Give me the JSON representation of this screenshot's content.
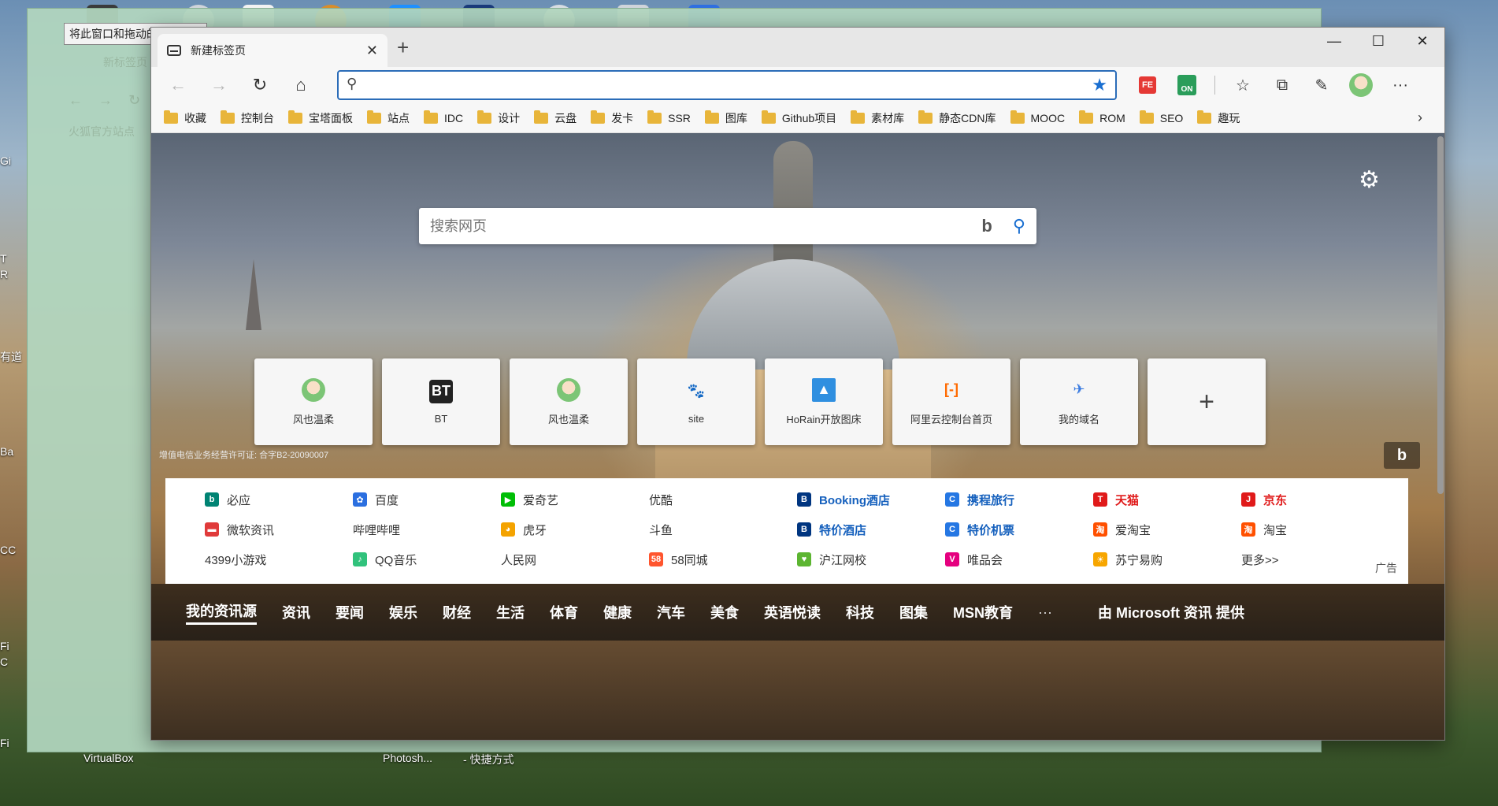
{
  "desktop": {
    "ghost_tooltip": "将此窗口和拖动的窗口分组",
    "ghost_tab": "新标签页",
    "ghost_bookmark": "火狐官方站点",
    "left_labels": [
      "Gi",
      "T",
      "R",
      "有道",
      "Ba",
      "CC",
      "Fi",
      "C",
      "Fi"
    ],
    "bottom_labels": [
      "VirtualBox",
      "Photosh...",
      "- 快捷方式"
    ]
  },
  "browser": {
    "tab_title": "新建标签页",
    "address_placeholder": "",
    "bookmarks": [
      "收藏",
      "控制台",
      "宝塔面板",
      "站点",
      "IDC",
      "设计",
      "云盘",
      "发卡",
      "SSR",
      "图库",
      "Github项目",
      "素材库",
      "静态CDN库",
      "MOOC",
      "ROM",
      "SEO",
      "趣玩"
    ],
    "ext_fe": "FE",
    "ext_on": "ON"
  },
  "newtab": {
    "search_placeholder": "搜索网页",
    "tiles": [
      {
        "label": "风也温柔",
        "icon": "avatar-icon"
      },
      {
        "label": "BT",
        "icon": "bt-icon"
      },
      {
        "label": "风也温柔",
        "icon": "avatar-icon"
      },
      {
        "label": "site",
        "icon": "baidu-paw-icon"
      },
      {
        "label": "HoRain开放图床",
        "icon": "image-icon"
      },
      {
        "label": "阿里云控制台首页",
        "icon": "aliyun-icon"
      },
      {
        "label": "我的域名",
        "icon": "plane-icon"
      }
    ],
    "tile_bt_text": "BT",
    "license": "增值电信业务经营许可证: 合字B2-20090007",
    "links": [
      {
        "label": "必应",
        "style": "normal",
        "icon": "bing",
        "color": "#008373"
      },
      {
        "label": "百度",
        "style": "normal",
        "icon": "baidu",
        "color": "#2b6fe0"
      },
      {
        "label": "爱奇艺",
        "style": "normal",
        "icon": "iqiyi",
        "color": "#00be06"
      },
      {
        "label": "优酷",
        "style": "normal",
        "icon": "",
        "color": ""
      },
      {
        "label": "Booking酒店",
        "style": "bold-blue",
        "icon": "booking",
        "color": "#003580"
      },
      {
        "label": "携程旅行",
        "style": "bold-blue",
        "icon": "ctrip",
        "color": "#2577e3"
      },
      {
        "label": "天猫",
        "style": "bold-red",
        "icon": "tmall",
        "color": "#e01a1a"
      },
      {
        "label": "京东",
        "style": "bold-red",
        "icon": "jd",
        "color": "#e01a1a"
      },
      {
        "label": "微软资讯",
        "style": "normal",
        "icon": "msn",
        "color": "#e03a3a"
      },
      {
        "label": "哔哩哔哩",
        "style": "normal",
        "icon": "",
        "color": ""
      },
      {
        "label": "虎牙",
        "style": "normal",
        "icon": "huya",
        "color": "#f4a300"
      },
      {
        "label": "斗鱼",
        "style": "normal",
        "icon": "",
        "color": ""
      },
      {
        "label": "特价酒店",
        "style": "bold-blue",
        "icon": "booking",
        "color": "#003580"
      },
      {
        "label": "特价机票",
        "style": "bold-blue",
        "icon": "ctrip",
        "color": "#2577e3"
      },
      {
        "label": "爱淘宝",
        "style": "normal",
        "icon": "taobao",
        "color": "#ff5000"
      },
      {
        "label": "淘宝",
        "style": "normal",
        "icon": "taobao",
        "color": "#ff5000"
      },
      {
        "label": "4399小游戏",
        "style": "normal",
        "icon": "",
        "color": ""
      },
      {
        "label": "QQ音乐",
        "style": "normal",
        "icon": "qqmusic",
        "color": "#31c27c"
      },
      {
        "label": "人民网",
        "style": "normal",
        "icon": "",
        "color": ""
      },
      {
        "label": "58同城",
        "style": "normal",
        "icon": "58",
        "color": "#ff552e"
      },
      {
        "label": "沪江网校",
        "style": "normal",
        "icon": "hujiang",
        "color": "#5cb531"
      },
      {
        "label": "唯品会",
        "style": "normal",
        "icon": "vip",
        "color": "#e5007f"
      },
      {
        "label": "苏宁易购",
        "style": "normal",
        "icon": "suning",
        "color": "#f7a600"
      },
      {
        "label": "更多>>",
        "style": "normal",
        "icon": "",
        "color": ""
      }
    ],
    "ad_label": "广告",
    "news_nav": [
      "我的资讯源",
      "资讯",
      "要闻",
      "娱乐",
      "财经",
      "生活",
      "体育",
      "健康",
      "汽车",
      "美食",
      "英语悦读",
      "科技",
      "图集",
      "MSN教育"
    ],
    "news_more": "···",
    "msn_credit": "由 Microsoft 资讯 提供"
  }
}
